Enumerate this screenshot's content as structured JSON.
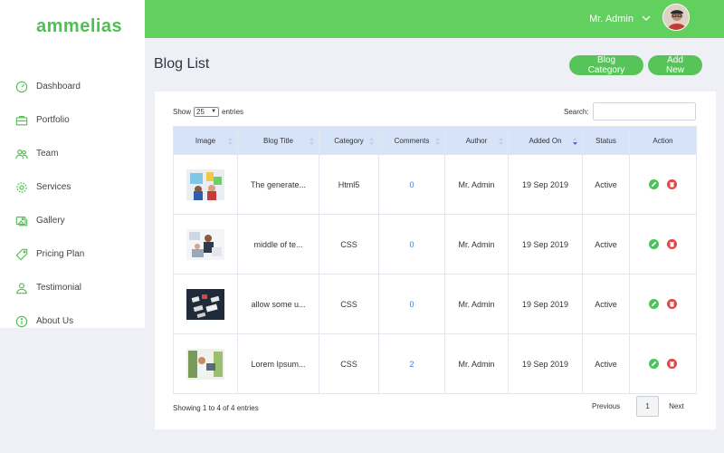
{
  "brand": {
    "logo": "ammelias",
    "accent": "#4cc34f",
    "topbar_color": "#62d05e"
  },
  "sidebar": {
    "items": [
      {
        "label": "Dashboard",
        "icon": "gauge-icon"
      },
      {
        "label": "Portfolio",
        "icon": "briefcase-icon"
      },
      {
        "label": "Team",
        "icon": "team-icon"
      },
      {
        "label": "Services",
        "icon": "gear-icon"
      },
      {
        "label": "Gallery",
        "icon": "gallery-icon"
      },
      {
        "label": "Pricing Plan",
        "icon": "tag-icon"
      },
      {
        "label": "Testimonial",
        "icon": "user-quote-icon"
      },
      {
        "label": "About Us",
        "icon": "info-icon"
      }
    ]
  },
  "header": {
    "user_name": "Mr. Admin"
  },
  "page": {
    "title": "Blog List",
    "buttons": {
      "category": "Blog Category",
      "add_new": "Add New"
    }
  },
  "table_controls": {
    "show_label": "Show",
    "entries_value": "25",
    "entries_label": "entries",
    "search_label": "Search:"
  },
  "table": {
    "headers": [
      "Image",
      "Blog Title",
      "Category",
      "Comments",
      "Author",
      "Added On",
      "Status",
      "Action"
    ],
    "rows": [
      {
        "title": "The generate...",
        "category": "Html5",
        "comments": "0",
        "author": "Mr. Admin",
        "added_on": "19 Sep 2019",
        "status": "Active"
      },
      {
        "title": "middle of te...",
        "category": "CSS",
        "comments": "0",
        "author": "Mr. Admin",
        "added_on": "19 Sep 2019",
        "status": "Active"
      },
      {
        "title": "allow some u...",
        "category": "CSS",
        "comments": "0",
        "author": "Mr. Admin",
        "added_on": "19 Sep 2019",
        "status": "Active"
      },
      {
        "title": "Lorem Ipsum...",
        "category": "CSS",
        "comments": "2",
        "author": "Mr. Admin",
        "added_on": "19 Sep 2019",
        "status": "Active"
      }
    ]
  },
  "footer": {
    "info": "Showing 1 to 4 of 4 entries",
    "previous": "Previous",
    "page": "1",
    "next": "Next"
  }
}
